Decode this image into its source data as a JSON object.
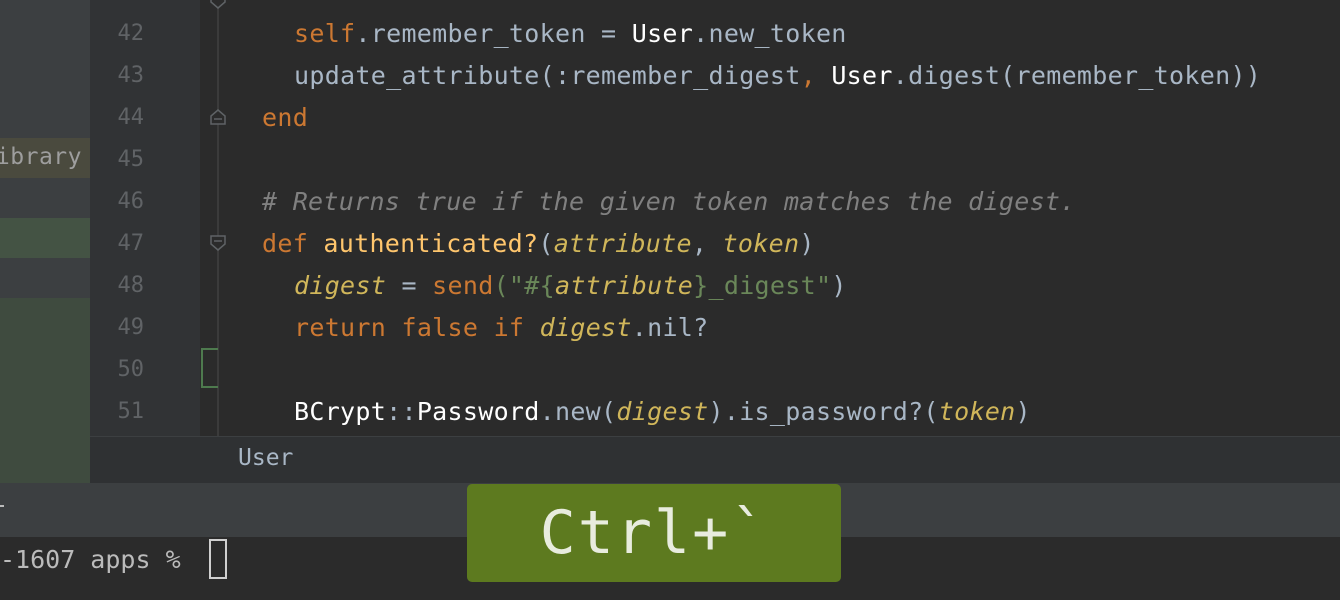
{
  "sidebar": {
    "library_label": "ibrary"
  },
  "editor": {
    "lines": [
      {
        "n": "42"
      },
      {
        "n": "43"
      },
      {
        "n": "44"
      },
      {
        "n": "45"
      },
      {
        "n": "46"
      },
      {
        "n": "47"
      },
      {
        "n": "48"
      },
      {
        "n": "49"
      },
      {
        "n": "50"
      },
      {
        "n": "51"
      }
    ],
    "code": {
      "l42": {
        "a": "self",
        "b": ".remember_token = ",
        "c": "User",
        "d": ".new_token"
      },
      "l43": {
        "a": "update_attribute(",
        "b": ":remember_digest",
        "c": ", ",
        "d": "User",
        "e": ".digest(remember_token))"
      },
      "l44": {
        "a": "end"
      },
      "l46": {
        "a": "# Returns true if the given token matches the digest."
      },
      "l47": {
        "a": "def ",
        "b": "authenticated?",
        "c": "(",
        "d": "attribute",
        "e": ", ",
        "f": "token",
        "g": ")"
      },
      "l48": {
        "a": "digest",
        "b": " = ",
        "c": "send",
        "d": "(\"#{",
        "e": "attribute",
        "f": "}_digest\"",
        "g": ")"
      },
      "l49": {
        "a": "return ",
        "b": "false ",
        "c": "if ",
        "d": "digest",
        "e": ".nil?"
      },
      "l51": {
        "a": "BCrypt",
        "b": "::",
        "c": "Password",
        "d": ".new(",
        "e": "digest",
        "f": ").is_password?(",
        "g": "token",
        "h": ")"
      }
    }
  },
  "breadcrumb": {
    "item": "User"
  },
  "terminal": {
    "prompt": "-1607 apps % "
  },
  "key_overlay": {
    "label": "Ctrl+`"
  },
  "colors": {
    "keyword": "#cc7832",
    "function": "#ffc66d",
    "comment": "#808080",
    "string": "#6a8759",
    "overlay": "#5d7a1f"
  }
}
